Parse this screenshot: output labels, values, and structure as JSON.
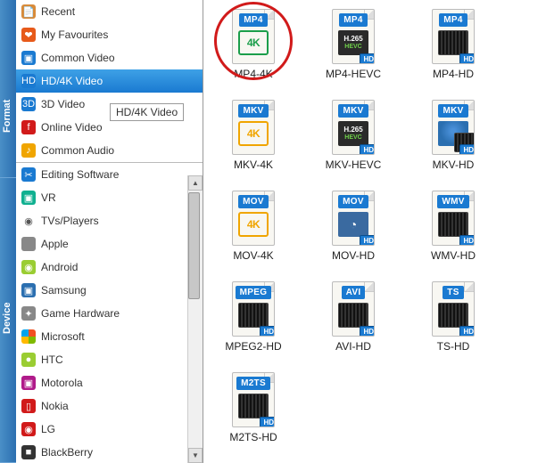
{
  "sidebar": {
    "tabs": {
      "format": "Format",
      "device": "Device"
    },
    "format_items": [
      {
        "label": "Recent",
        "icon": "📄",
        "iconBg": "#d88b3a",
        "name": "sidebar-recent"
      },
      {
        "label": "My Favourites",
        "icon": "❤",
        "iconBg": "#e75a1a",
        "name": "sidebar-favourites"
      },
      {
        "label": "Common Video",
        "icon": "▣",
        "iconBg": "#1a7ad1",
        "name": "sidebar-common-video"
      },
      {
        "label": "HD/4K Video",
        "icon": "HD",
        "iconBg": "#1a7ad1",
        "name": "sidebar-hd4k-video",
        "selected": true
      },
      {
        "label": "3D Video",
        "icon": "3D",
        "iconBg": "#1a7ad1",
        "name": "sidebar-3d-video"
      },
      {
        "label": "Online Video",
        "icon": "f",
        "iconBg": "#d11a1a",
        "name": "sidebar-online-video"
      },
      {
        "label": "Common Audio",
        "icon": "♪",
        "iconBg": "#f0a500",
        "name": "sidebar-common-audio"
      }
    ],
    "device_items": [
      {
        "label": "Editing Software",
        "icon": "✂",
        "iconBg": "#1a7ad1",
        "name": "sidebar-editing-software"
      },
      {
        "label": "VR",
        "icon": "▣",
        "iconBg": "#10b090",
        "name": "sidebar-vr"
      },
      {
        "label": "TVs/Players",
        "icon": "◉",
        "iconBg": "#fff",
        "iconColor": "#555",
        "name": "sidebar-tvs"
      },
      {
        "label": "Apple",
        "icon": "",
        "iconBg": "#888",
        "name": "sidebar-apple"
      },
      {
        "label": "Android",
        "icon": "◉",
        "iconBg": "#9acd32",
        "name": "sidebar-android"
      },
      {
        "label": "Samsung",
        "icon": "▣",
        "iconBg": "#2b6fb0",
        "name": "sidebar-samsung"
      },
      {
        "label": "Game Hardware",
        "icon": "✦",
        "iconBg": "#888",
        "name": "sidebar-game-hardware"
      },
      {
        "label": "Microsoft",
        "icon": "◫",
        "iconBg": "#fff",
        "name": "sidebar-microsoft",
        "msLogo": true
      },
      {
        "label": "HTC",
        "icon": "●",
        "iconBg": "#9acd32",
        "name": "sidebar-htc"
      },
      {
        "label": "Motorola",
        "icon": "▣",
        "iconBg": "#b01a8a",
        "name": "sidebar-motorola"
      },
      {
        "label": "Nokia",
        "icon": "▯",
        "iconBg": "#d11a1a",
        "name": "sidebar-nokia"
      },
      {
        "label": "LG",
        "icon": "◉",
        "iconBg": "#d11a1a",
        "name": "sidebar-lg"
      },
      {
        "label": "BlackBerry",
        "icon": "■",
        "iconBg": "#333",
        "name": "sidebar-blackberry"
      }
    ],
    "tooltip": "HD/4K Video"
  },
  "formats": [
    {
      "name": "format-mp4-4k",
      "label": "MP4-4K",
      "badge": "MP4",
      "style": "4k-green",
      "highlight": true
    },
    {
      "name": "format-mp4-hevc",
      "label": "MP4-HEVC",
      "badge": "MP4",
      "style": "h265"
    },
    {
      "name": "format-mp4-hd",
      "label": "MP4-HD",
      "badge": "MP4",
      "style": "film"
    },
    {
      "name": "format-mkv-4k",
      "label": "MKV-4K",
      "badge": "MKV",
      "style": "4k"
    },
    {
      "name": "format-mkv-hevc",
      "label": "MKV-HEVC",
      "badge": "MKV",
      "style": "h265"
    },
    {
      "name": "format-mkv-hd",
      "label": "MKV-HD",
      "badge": "MKV",
      "style": "matroska"
    },
    {
      "name": "format-mov-4k",
      "label": "MOV-4K",
      "badge": "MOV",
      "style": "4k"
    },
    {
      "name": "format-mov-hd",
      "label": "MOV-HD",
      "badge": "MOV",
      "style": "qt"
    },
    {
      "name": "format-wmv-hd",
      "label": "WMV-HD",
      "badge": "WMV",
      "style": "film"
    },
    {
      "name": "format-mpeg2-hd",
      "label": "MPEG2-HD",
      "badge": "MPEG",
      "style": "film"
    },
    {
      "name": "format-avi-hd",
      "label": "AVI-HD",
      "badge": "AVI",
      "style": "film"
    },
    {
      "name": "format-ts-hd",
      "label": "TS-HD",
      "badge": "TS",
      "style": "film"
    },
    {
      "name": "format-m2ts-hd",
      "label": "M2TS-HD",
      "badge": "M2TS",
      "style": "film"
    }
  ]
}
